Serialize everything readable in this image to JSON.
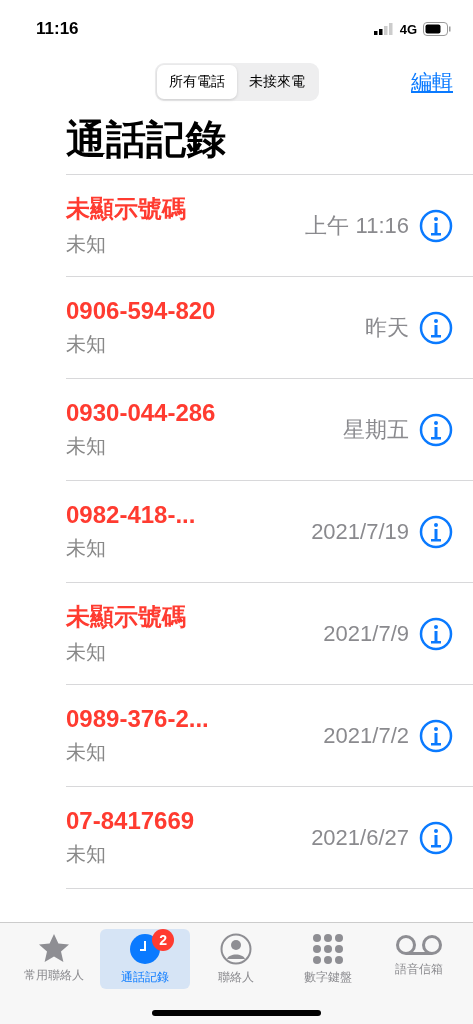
{
  "status_bar": {
    "time": "11:16",
    "network": "4G"
  },
  "segments": [
    {
      "label": "所有電話",
      "selected": true
    },
    {
      "label": "未接來電",
      "selected": false
    }
  ],
  "edit_link": "編輯",
  "title": "通話記錄",
  "calls": [
    {
      "caller": "未顯示號碼",
      "type": "未知",
      "time": "上午 11:16",
      "missed": true
    },
    {
      "caller": "0906-594-820",
      "type": "未知",
      "time": "昨天",
      "missed": true
    },
    {
      "caller": "0930-044-286",
      "type": "未知",
      "time": "星期五",
      "missed": true
    },
    {
      "caller": "0982-418-...",
      "type": "未知",
      "time": "2021/7/19",
      "missed": true
    },
    {
      "caller": "未顯示號碼",
      "type": "未知",
      "time": "2021/7/9",
      "missed": true
    },
    {
      "caller": "0989-376-2...",
      "type": "未知",
      "time": "2021/7/2",
      "missed": true
    },
    {
      "caller": "07-8417669",
      "type": "未知",
      "time": "2021/6/27",
      "missed": true
    }
  ],
  "tab_bar": [
    {
      "label": "常用聯絡人",
      "kind": "star",
      "selected": false
    },
    {
      "label": "通話記錄",
      "kind": "clock",
      "selected": true,
      "badge": "2"
    },
    {
      "label": "聯絡人",
      "kind": "person",
      "selected": false
    },
    {
      "label": "數字鍵盤",
      "kind": "keypad",
      "selected": false
    },
    {
      "label": "語音信箱",
      "kind": "voicemail",
      "selected": false
    }
  ]
}
